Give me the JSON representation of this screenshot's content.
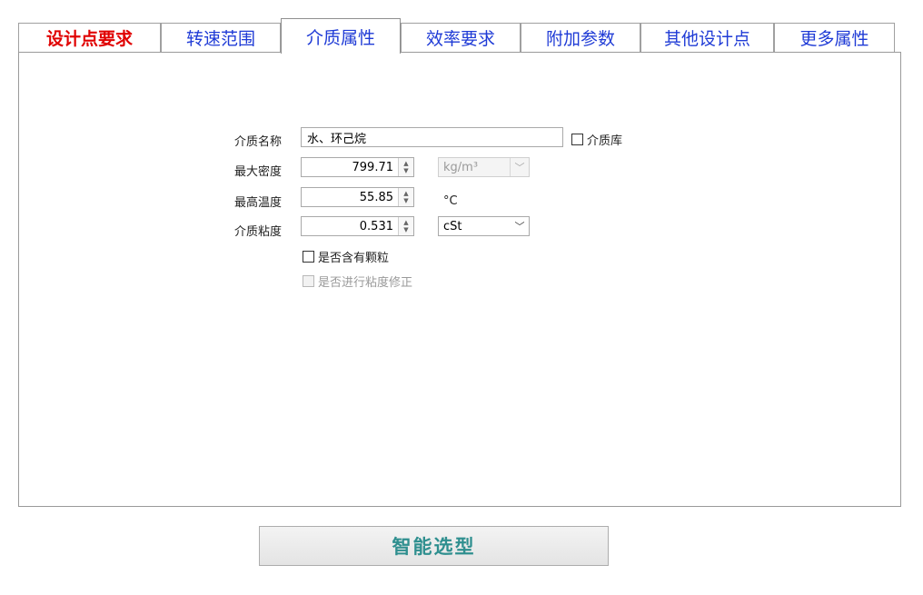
{
  "tabs": [
    {
      "label": "设计点要求",
      "style": "red"
    },
    {
      "label": "转速范围"
    },
    {
      "label": "介质属性",
      "active": true
    },
    {
      "label": "效率要求"
    },
    {
      "label": "附加参数"
    },
    {
      "label": "其他设计点"
    },
    {
      "label": "更多属性"
    }
  ],
  "form": {
    "medium_name_label": "介质名称",
    "medium_name_value": "水、环己烷",
    "medium_library_label": "介质库",
    "max_density_label": "最大密度",
    "max_density_value": "799.71",
    "density_unit": "kg/m³",
    "max_temp_label": "最高温度",
    "max_temp_value": "55.85",
    "temp_unit": "°C",
    "viscosity_label": "介质粘度",
    "viscosity_value": "0.531",
    "viscosity_unit": "cSt",
    "particles_label": "是否含有颗粒",
    "viscosity_correction_label": "是否进行粘度修正"
  },
  "actions": {
    "smart_select_label": "智能选型"
  },
  "colors": {
    "tab_text": "#1f3bd6",
    "tab_highlight": "#e00000",
    "button_text": "#2f8f8f"
  }
}
